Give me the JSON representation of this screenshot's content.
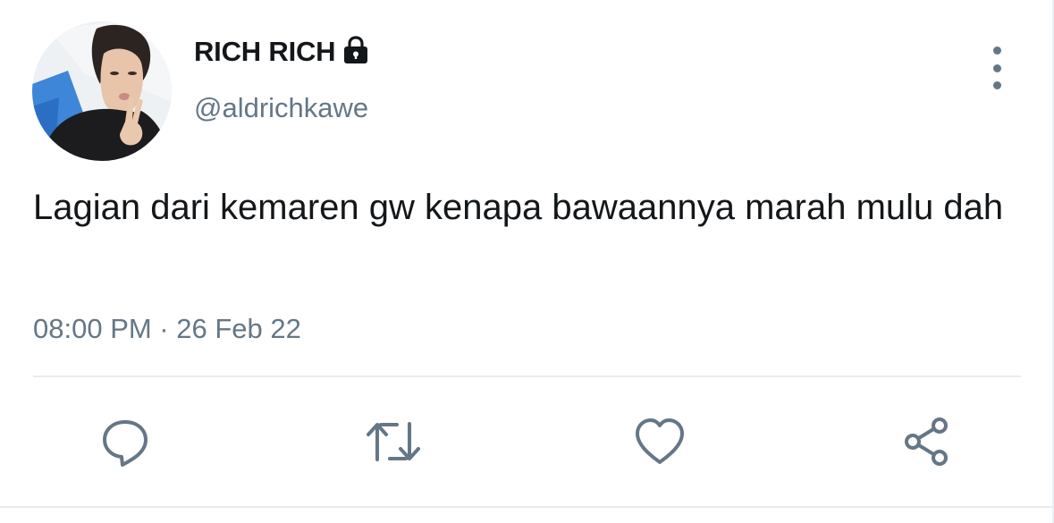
{
  "user": {
    "display_name": "RICH RICH",
    "handle": "@aldrichkawe",
    "avatar_icon": "user-avatar",
    "protected_icon": "lock-icon"
  },
  "tweet": {
    "text": "Lagian dari kemaren gw kenapa bawaannya marah mulu dah",
    "timestamp": "08:00 PM · 26 Feb 22"
  },
  "actions": {
    "more_icon": "more-vertical-icon",
    "reply_icon": "reply-icon",
    "retweet_icon": "retweet-icon",
    "like_icon": "heart-icon",
    "share_icon": "share-icon"
  },
  "colors": {
    "text_primary": "#14171a",
    "text_secondary": "#657786",
    "divider": "#e6ecf0",
    "icon": "#657786"
  }
}
